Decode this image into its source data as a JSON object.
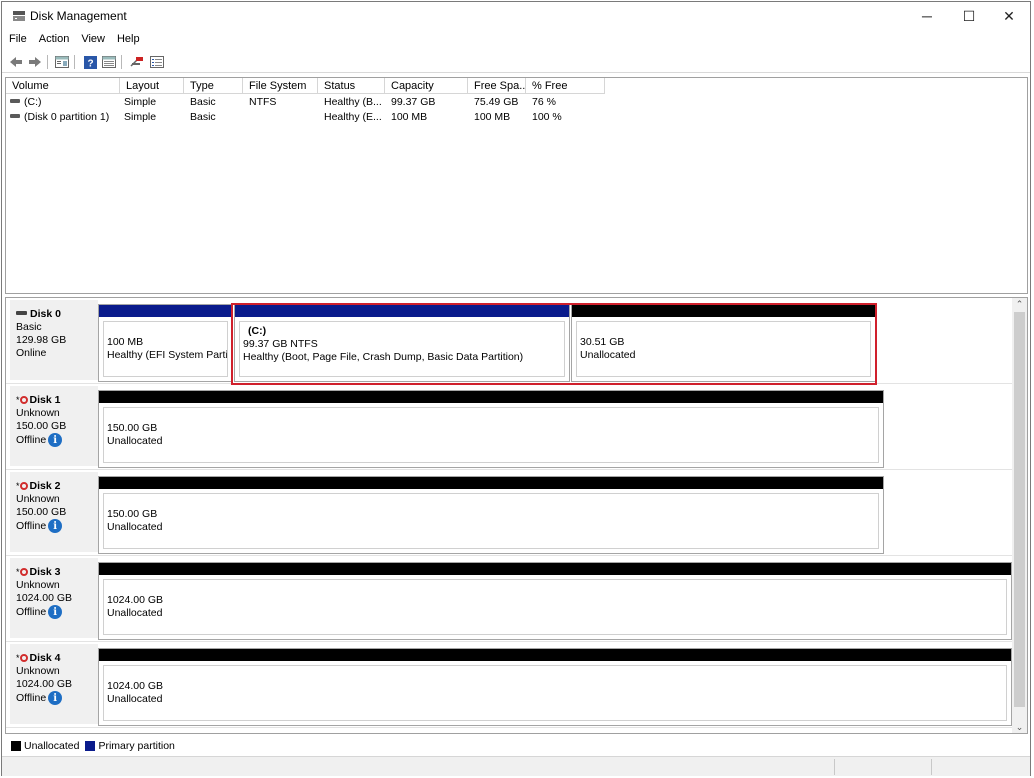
{
  "window": {
    "title": "Disk Management",
    "controls": {
      "minimize": "─",
      "maximize": "☐",
      "close": "✕"
    }
  },
  "menu": [
    "File",
    "Action",
    "View",
    "Help"
  ],
  "toolbar": [
    "back-icon",
    "forward-icon",
    "properties-icon",
    "help-icon",
    "details-icon",
    "connect-icon",
    "list-icon"
  ],
  "volumes": {
    "columns": [
      "Volume",
      "Layout",
      "Type",
      "File System",
      "Status",
      "Capacity",
      "Free Spa...",
      "% Free"
    ],
    "rows": [
      {
        "volume": "(C:)",
        "layout": "Simple",
        "type": "Basic",
        "fs": "NTFS",
        "status": "Healthy (B...",
        "capacity": "99.37 GB",
        "free": "75.49 GB",
        "pct": "76 %"
      },
      {
        "volume": "(Disk 0 partition 1)",
        "layout": "Simple",
        "type": "Basic",
        "fs": "",
        "status": "Healthy (E...",
        "capacity": "100 MB",
        "free": "100 MB",
        "pct": "100 %"
      }
    ]
  },
  "disks": [
    {
      "name": "Disk 0",
      "type": "Basic",
      "size": "129.98 GB",
      "state": "Online",
      "partitions": [
        {
          "name": "",
          "line1": "100 MB",
          "line2": "Healthy (EFI System Partiti",
          "kind": "primary"
        },
        {
          "name": "(C:)",
          "line1": "99.37 GB NTFS",
          "line2": "Healthy (Boot, Page File, Crash Dump, Basic Data Partition)",
          "kind": "primary"
        },
        {
          "name": "",
          "line1": "30.51 GB",
          "line2": "Unallocated",
          "kind": "unallocated"
        }
      ]
    },
    {
      "name": "Disk 1",
      "type": "Unknown",
      "size": "150.00 GB",
      "state": "Offline",
      "partitions": [
        {
          "name": "",
          "line1": "150.00 GB",
          "line2": "Unallocated",
          "kind": "unallocated"
        }
      ]
    },
    {
      "name": "Disk 2",
      "type": "Unknown",
      "size": "150.00 GB",
      "state": "Offline",
      "partitions": [
        {
          "name": "",
          "line1": "150.00 GB",
          "line2": "Unallocated",
          "kind": "unallocated"
        }
      ]
    },
    {
      "name": "Disk 3",
      "type": "Unknown",
      "size": "1024.00 GB",
      "state": "Offline",
      "partitions": [
        {
          "name": "",
          "line1": "1024.00 GB",
          "line2": "Unallocated",
          "kind": "unallocated"
        }
      ]
    },
    {
      "name": "Disk 4",
      "type": "Unknown",
      "size": "1024.00 GB",
      "state": "Offline",
      "partitions": [
        {
          "name": "",
          "line1": "1024.00 GB",
          "line2": "Unallocated",
          "kind": "unallocated"
        }
      ]
    }
  ],
  "legend": [
    {
      "label": "Unallocated",
      "color": "#000000"
    },
    {
      "label": "Primary partition",
      "color": "#0a1b8c"
    }
  ],
  "colors": {
    "primary": "#0a1b8c",
    "unallocated": "#000000",
    "highlight": "#d0202c",
    "info": "#1e6ec4"
  }
}
